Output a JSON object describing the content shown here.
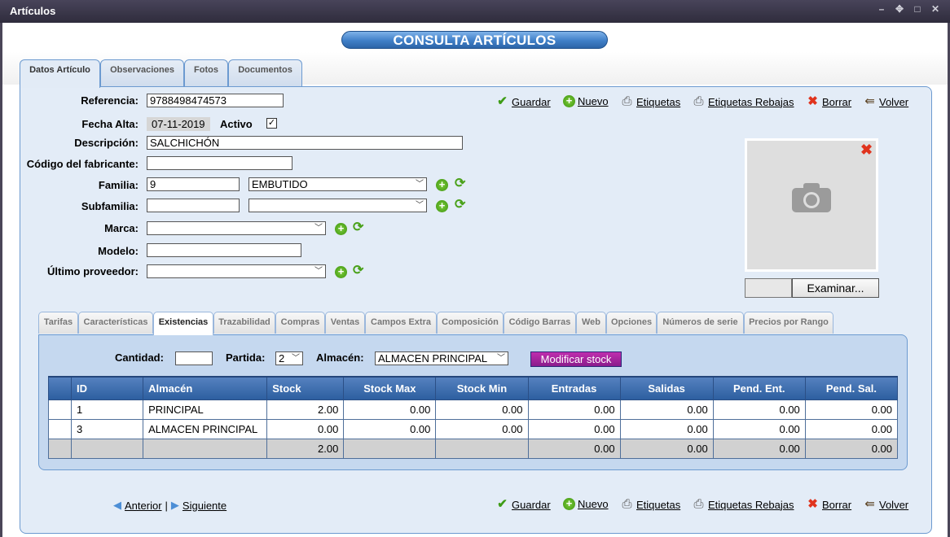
{
  "window": {
    "title": "Artículos",
    "controls": [
      "–",
      "✥",
      "□",
      "✕"
    ]
  },
  "banner": "CONSULTA ARTÍCULOS",
  "main_tabs": [
    "Datos Artículo",
    "Observaciones",
    "Fotos",
    "Documentos"
  ],
  "toolbar": {
    "save": "Guardar",
    "new": "Nuevo",
    "labels": "Etiquetas",
    "labels_sale": "Etiquetas Rebajas",
    "delete": "Borrar",
    "back": "Volver"
  },
  "form": {
    "referencia_label": "Referencia:",
    "referencia": "9788498474573",
    "fecha_alta_label": "Fecha Alta:",
    "fecha_alta": "07-11-2019",
    "activo_label": "Activo",
    "activo_checked": "✓",
    "descripcion_label": "Descripción:",
    "descripcion": "SALCHICHÓN",
    "codigo_fab_label": "Código del fabricante:",
    "codigo_fab": "",
    "familia_label": "Familia:",
    "familia_code": "9",
    "familia_name": "EMBUTIDO",
    "subfamilia_label": "Subfamilia:",
    "subfamilia_code": "",
    "subfamilia_name": "",
    "marca_label": "Marca:",
    "marca": "",
    "modelo_label": "Modelo:",
    "modelo": "",
    "proveedor_label": "Último proveedor:",
    "proveedor": ""
  },
  "photo": {
    "browse": "Examinar..."
  },
  "sub_tabs": [
    "Tarifas",
    "Características",
    "Existencias",
    "Trazabilidad",
    "Compras",
    "Ventas",
    "Campos Extra",
    "Composición",
    "Código Barras",
    "Web",
    "Opciones",
    "Números de serie",
    "Precios por Rango"
  ],
  "stock": {
    "cantidad_label": "Cantidad:",
    "cantidad": "",
    "partida_label": "Partida:",
    "partida": "2",
    "almacen_label": "Almacén:",
    "almacen": "ALMACEN PRINCIPAL",
    "modify_button": "Modificar stock"
  },
  "table": {
    "headers": [
      "ID",
      "Almacén",
      "Stock",
      "Stock Max",
      "Stock Min",
      "Entradas",
      "Salidas",
      "Pend. Ent.",
      "Pend. Sal."
    ],
    "rows": [
      [
        "1",
        "PRINCIPAL",
        "2.00",
        "0.00",
        "0.00",
        "0.00",
        "0.00",
        "0.00",
        "0.00"
      ],
      [
        "3",
        "ALMACEN PRINCIPAL",
        "0.00",
        "0.00",
        "0.00",
        "0.00",
        "0.00",
        "0.00",
        "0.00"
      ]
    ],
    "total": [
      "",
      "",
      "2.00",
      "",
      "",
      "0.00",
      "0.00",
      "0.00",
      "0.00"
    ]
  },
  "pager": {
    "prev": "Anterior",
    "sep": "|",
    "next": "Siguiente"
  }
}
